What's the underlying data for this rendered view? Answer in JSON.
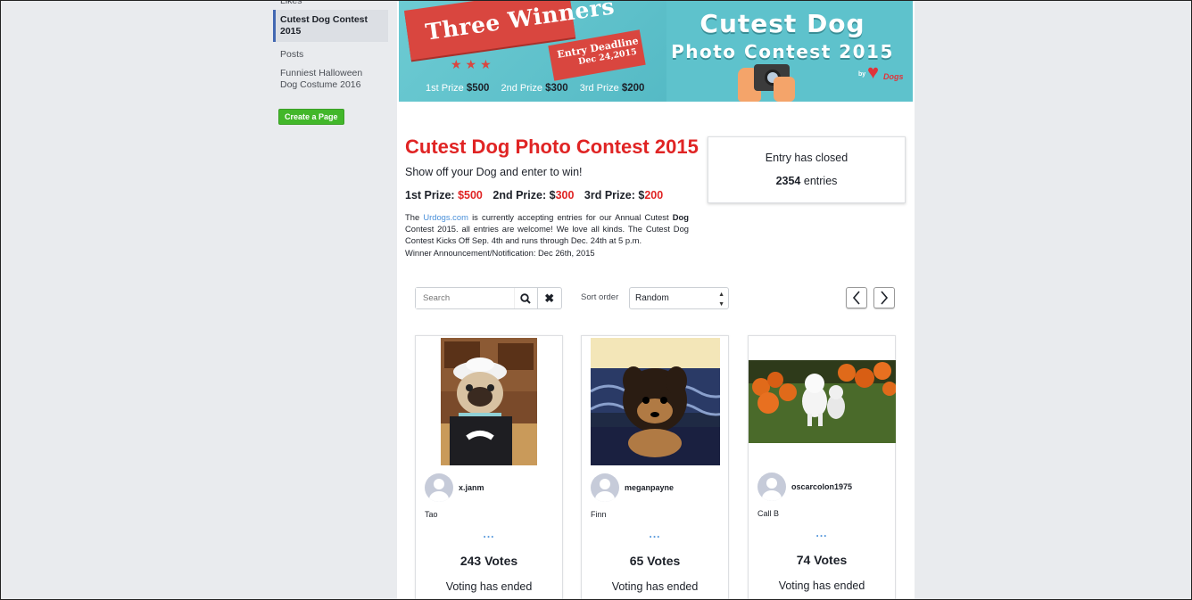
{
  "sidebar": {
    "partial_item": "Likes",
    "items": [
      {
        "label": "Cutest Dog Contest 2015",
        "active": true
      },
      {
        "label": "Posts"
      },
      {
        "label": "Funniest Halloween Dog Costume 2016"
      }
    ],
    "create_button": "Create a Page"
  },
  "banner": {
    "ribbon": "Three Winners",
    "deadline_label": "Entry Deadline",
    "deadline_date": "Dec 24,2015",
    "prize1_label": "1st Prize",
    "prize1_value": "$500",
    "prize2_label": "2nd Prize",
    "prize2_value": "$300",
    "prize3_label": "3rd Prize",
    "prize3_value": "$200",
    "title_line1": "Cutest Dog",
    "title_line2": "Photo Contest 2015",
    "logo_by": "by",
    "logo_brand": "Dogs"
  },
  "contest": {
    "title": "Cutest Dog Photo Contest 2015",
    "tagline": "Show off your Dog and enter to win!",
    "prize1_label": "1st Prize:",
    "prize1_value": "$500",
    "prize2_label": "2nd Prize:",
    "prize2_prefix": "$",
    "prize2_value": "300",
    "prize3_label": "3rd Prize:",
    "prize3_prefix": "$",
    "prize3_value": "200",
    "desc_pre": "The ",
    "desc_link": "Urdogs.com",
    "desc_mid": " is currently accepting entries for our Annual Cutest ",
    "desc_bold": "Dog",
    "desc_post": " Contest 2015. all entries are welcome! We love all kinds. The Cutest Dog Contest Kicks Off Sep. 4th and runs through Dec. 24th at 5 p.m.",
    "desc_line2": "Winner Announcement/Notification: Dec 26th, 2015"
  },
  "status": {
    "closed": "Entry has closed",
    "count": "2354",
    "count_suffix": "entries"
  },
  "toolbar": {
    "search_placeholder": "Search",
    "sort_label": "Sort order",
    "sort_value": "Random"
  },
  "entries": [
    {
      "username": "x.janm",
      "dog": "Tao",
      "dots": "...",
      "votes": "243 Votes",
      "status": "Voting has ended"
    },
    {
      "username": "meganpayne",
      "dog": "Finn",
      "dots": "...",
      "votes": "65 Votes",
      "status": "Voting has ended"
    },
    {
      "username": "oscarcolon1975",
      "dog": "Call B",
      "dots": "...",
      "votes": "74 Votes",
      "status": "Voting has ended"
    }
  ],
  "colors": {
    "accent_red": "#e02424",
    "link_blue": "#4a90d9",
    "banner_teal": "#5ec2cc",
    "create_green": "#42b72a"
  }
}
